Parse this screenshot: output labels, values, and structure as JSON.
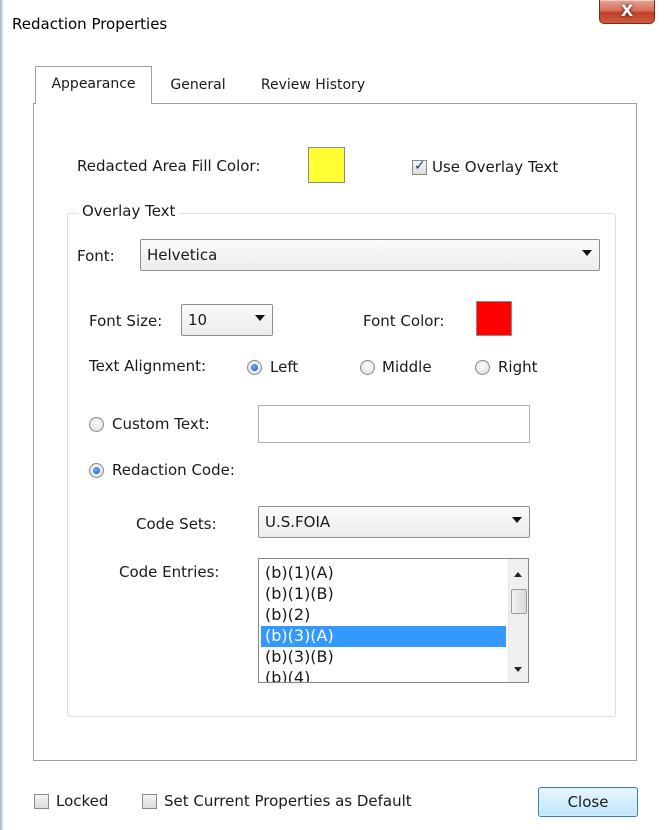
{
  "window": {
    "title": "Redaction Properties",
    "close_glyph": "X"
  },
  "tabs": [
    {
      "label": "Appearance",
      "active": true
    },
    {
      "label": "General",
      "active": false
    },
    {
      "label": "Review History",
      "active": false
    }
  ],
  "appearance": {
    "fill_color_label": "Redacted Area Fill Color:",
    "fill_color": "#ffff33",
    "use_overlay_label": "Use Overlay Text",
    "use_overlay_checked": true,
    "overlay": {
      "group_title": "Overlay Text",
      "font_label": "Font:",
      "font_value": "Helvetica",
      "font_size_label": "Font Size:",
      "font_size_value": "10",
      "font_color_label": "Font Color:",
      "font_color": "#ff0000",
      "alignment_label": "Text Alignment:",
      "alignment_options": [
        "Left",
        "Middle",
        "Right"
      ],
      "alignment_selected": "Left",
      "custom_text_label": "Custom Text:",
      "custom_text_value": "",
      "redaction_code_label": "Redaction Code:",
      "mode_selected": "Redaction Code",
      "code_sets_label": "Code Sets:",
      "code_sets_value": "U.S.FOIA",
      "code_entries_label": "Code Entries:",
      "code_entries": [
        "(b)(1)(A)",
        "(b)(1)(B)",
        "(b)(2)",
        "(b)(3)(A)",
        "(b)(3)(B)",
        "(b)(4)"
      ],
      "code_entry_selected": "(b)(3)(A)"
    }
  },
  "footer": {
    "locked_label": "Locked",
    "locked_checked": false,
    "default_label": "Set Current Properties as Default",
    "default_checked": false,
    "close_label": "Close"
  }
}
